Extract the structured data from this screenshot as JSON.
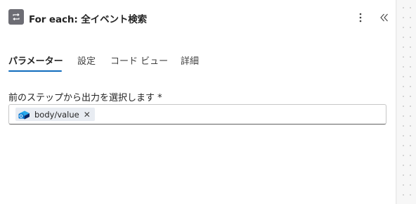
{
  "header": {
    "title": "For each: 全イベント検索",
    "action_icon": "loop-icon",
    "more_icon": "more-vertical-icon",
    "collapse_icon": "double-chevron-left-icon"
  },
  "tabs": [
    {
      "label": "パラメーター",
      "active": true
    },
    {
      "label": "設定",
      "active": false
    },
    {
      "label": "コード ビュー",
      "active": false
    },
    {
      "label": "詳細",
      "active": false
    }
  ],
  "field": {
    "label": "前のステップから出力を選択します *",
    "token": {
      "label": "body/value",
      "icon": "outlook-calendar-icon",
      "remove_symbol": "✕"
    }
  },
  "colors": {
    "accent": "#0f6cbd",
    "action_icon_bg": "#6d6d74"
  }
}
